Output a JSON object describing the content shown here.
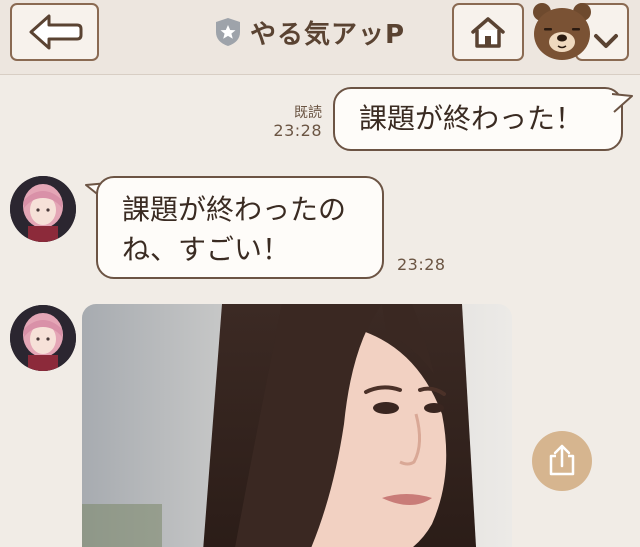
{
  "header": {
    "back_icon": "arrow-left-icon",
    "badge_icon": "shield-star-icon",
    "title": "やる気アッP",
    "home_icon": "home-icon",
    "chevron_icon": "chevron-down-icon",
    "mascot": "bear-mascot-avatar"
  },
  "messages": {
    "sent": {
      "text": "課題が終わった！",
      "read_label": "既読",
      "time": "23:28"
    },
    "received": {
      "line1": "課題が終わったの",
      "line2": "ね、すごい！",
      "time": "23:28"
    },
    "photo": {
      "type": "image-message"
    }
  },
  "actions": {
    "share_icon": "share-icon"
  },
  "colors": {
    "background": "#f1ece6",
    "header": "#ede6df",
    "accent_brown": "#6c5444",
    "share_button": "#d6b58f"
  }
}
